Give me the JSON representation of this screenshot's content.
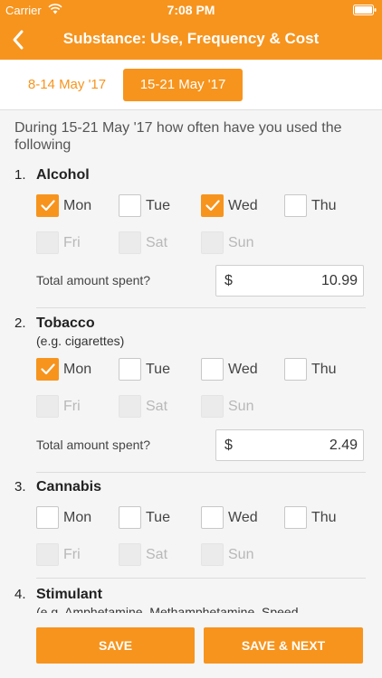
{
  "status": {
    "carrier": "Carrier",
    "time": "7:08 PM",
    "wifi_icon": "wifi-icon",
    "battery_icon": "battery-icon"
  },
  "nav": {
    "title": "Substance: Use, Frequency & Cost",
    "back_icon": "chevron-left-icon"
  },
  "weeks": {
    "previous": "8-14 May '17",
    "current": "15-21 May '17"
  },
  "intro": "During 15-21 May '17 how often have you used the following",
  "days": [
    "Mon",
    "Tue",
    "Wed",
    "Thu",
    "Fri",
    "Sat",
    "Sun"
  ],
  "amount_label": "Total amount spent?",
  "currency": "$",
  "questions": [
    {
      "number": "1.",
      "name": "Alcohol",
      "checked": [
        true,
        false,
        true,
        false,
        false,
        false,
        false
      ],
      "amount": "10.99"
    },
    {
      "number": "2.",
      "name": "Tobacco",
      "subtitle": "(e.g. cigarettes)",
      "checked": [
        true,
        false,
        false,
        false,
        false,
        false,
        false
      ],
      "amount": "2.49"
    },
    {
      "number": "3.",
      "name": "Cannabis",
      "checked": [
        false,
        false,
        false,
        false,
        false,
        false,
        false
      ]
    },
    {
      "number": "4.",
      "name": "Stimulant",
      "subtitle": "(e.g. Amphetamine, Methamphetamine, Speed"
    }
  ],
  "buttons": {
    "save": "SAVE",
    "save_next": "SAVE & NEXT"
  },
  "colors": {
    "accent": "#f7941d",
    "background": "#f5f5f5"
  }
}
